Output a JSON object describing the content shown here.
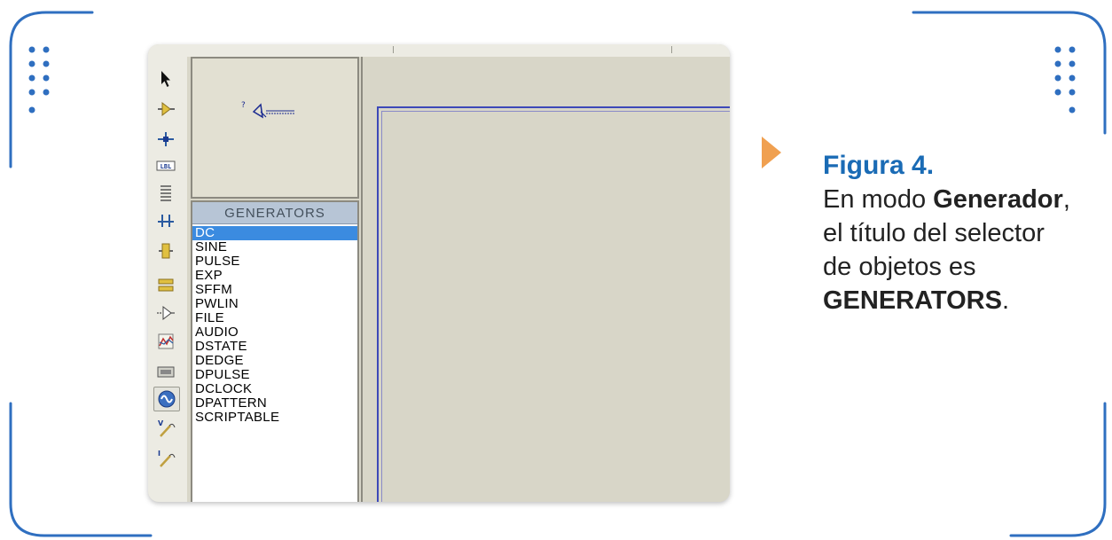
{
  "colors": {
    "frame": "#2f6fc0",
    "arrow": "#f0a050",
    "figure_label": "#1a6bb5",
    "selected_item": "#3b8be0",
    "sheet_border": "#3d49b8"
  },
  "toolbar": {
    "tools": [
      "selection-arrow-icon",
      "component-icon",
      "junction-dot-icon",
      "wire-label-icon",
      "text-script-icon",
      "bus-icon",
      "subcircuit-icon",
      "terminals-icon",
      "device-pins-icon",
      "graph-icon",
      "tape-recorder-icon",
      "generator-icon",
      "voltage-probe-icon",
      "current-probe-icon"
    ],
    "active_tool": "generator-icon"
  },
  "selector": {
    "title": "GENERATORS",
    "items": [
      "DC",
      "SINE",
      "PULSE",
      "EXP",
      "SFFM",
      "PWLIN",
      "FILE",
      "AUDIO",
      "DSTATE",
      "DEDGE",
      "DPULSE",
      "DCLOCK",
      "DPATTERN",
      "SCRIPTABLE"
    ],
    "selected": "DC"
  },
  "caption": {
    "figure": "Figura 4.",
    "text_1": "En modo ",
    "mode": "Generador",
    "text_2": ", el título del selector de objetos es ",
    "title_name": "GENERATORS",
    "end": "."
  }
}
